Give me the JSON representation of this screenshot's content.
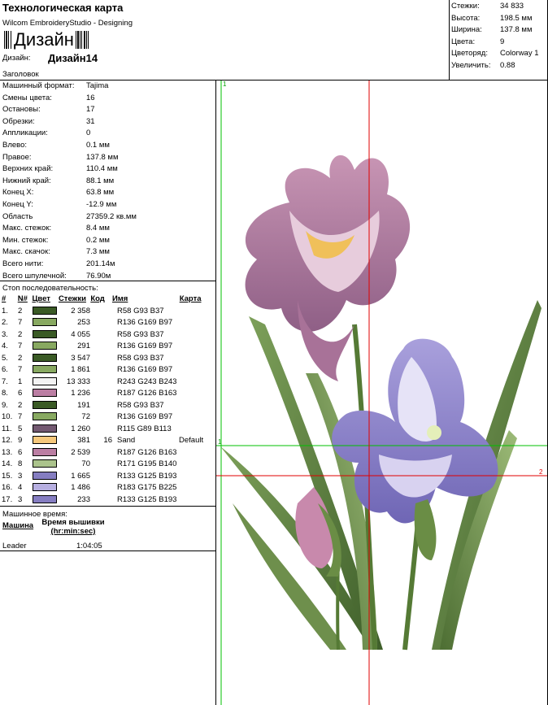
{
  "header": {
    "title": "Технологическая карта",
    "subtitle": "Wilcom EmbroideryStudio - Designing",
    "barcode_text": "Дизайн",
    "design_label": "Дизайн:",
    "design_name": "Дизайн14",
    "heading_label": "Заголовок"
  },
  "top_stats": [
    {
      "k": "Стежки:",
      "v": "34 833"
    },
    {
      "k": "Высота:",
      "v": "198.5 мм"
    },
    {
      "k": "Ширина:",
      "v": "137.8 мм"
    },
    {
      "k": "Цвета:",
      "v": "9"
    },
    {
      "k": "Цветоряд:",
      "v": "Colorway 1"
    },
    {
      "k": "Увеличить:",
      "v": "0.88"
    }
  ],
  "info": [
    {
      "k": "Машинный формат:",
      "v": "Tajima"
    },
    {
      "k": "Смены цвета:",
      "v": "16"
    },
    {
      "k": "Остановы:",
      "v": "17"
    },
    {
      "k": "Обрезки:",
      "v": "31"
    },
    {
      "k": "Аппликации:",
      "v": "0"
    },
    {
      "k": "Влево:",
      "v": "0.1 мм"
    },
    {
      "k": "Правое:",
      "v": "137.8 мм"
    },
    {
      "k": "Верхних край:",
      "v": "110.4 мм"
    },
    {
      "k": "Нижний край:",
      "v": "88.1 мм"
    },
    {
      "k": "Конец X:",
      "v": "63.8 мм"
    },
    {
      "k": "Конец Y:",
      "v": "-12.9 мм"
    },
    {
      "k": "Область",
      "v": "27359.2 кв.мм"
    },
    {
      "k": "Макс. стежок:",
      "v": "8.4 мм"
    },
    {
      "k": "Мин. стежок:",
      "v": "0.2 мм"
    },
    {
      "k": "Макс. скачок:",
      "v": "7.3 мм"
    },
    {
      "k": "Всего нити:",
      "v": "201.14м"
    },
    {
      "k": "Всего шпулечной:",
      "v": "76.90м"
    }
  ],
  "stop_sequence": {
    "title": "Стоп последовательность:",
    "headers": {
      "num": "#",
      "n": "N#",
      "color": "Цвет",
      "stitches": "Стежки",
      "code": "Код",
      "name": "Имя",
      "chart": "Карта"
    },
    "rows": [
      {
        "num": "1.",
        "n": "2",
        "color": "#3a5a25",
        "stitches": "2 358",
        "code": "",
        "name": "R58 G93 B37",
        "chart": ""
      },
      {
        "num": "2.",
        "n": "7",
        "color": "#88a961",
        "stitches": "253",
        "code": "",
        "name": "R136 G169 B97",
        "chart": ""
      },
      {
        "num": "3.",
        "n": "2",
        "color": "#3a5a25",
        "stitches": "4 055",
        "code": "",
        "name": "R58 G93 B37",
        "chart": ""
      },
      {
        "num": "4.",
        "n": "7",
        "color": "#88a961",
        "stitches": "291",
        "code": "",
        "name": "R136 G169 B97",
        "chart": ""
      },
      {
        "num": "5.",
        "n": "2",
        "color": "#3a5a25",
        "stitches": "3 547",
        "code": "",
        "name": "R58 G93 B37",
        "chart": ""
      },
      {
        "num": "6.",
        "n": "7",
        "color": "#88a961",
        "stitches": "1 861",
        "code": "",
        "name": "R136 G169 B97",
        "chart": ""
      },
      {
        "num": "7.",
        "n": "1",
        "color": "#f3f3f3",
        "stitches": "13 333",
        "code": "",
        "name": "R243 G243 B243",
        "chart": ""
      },
      {
        "num": "8.",
        "n": "6",
        "color": "#bb7ea3",
        "stitches": "1 236",
        "code": "",
        "name": "R187 G126 B163",
        "chart": ""
      },
      {
        "num": "9.",
        "n": "2",
        "color": "#3a5a25",
        "stitches": "191",
        "code": "",
        "name": "R58 G93 B37",
        "chart": ""
      },
      {
        "num": "10.",
        "n": "7",
        "color": "#88a961",
        "stitches": "72",
        "code": "",
        "name": "R136 G169 B97",
        "chart": ""
      },
      {
        "num": "11.",
        "n": "5",
        "color": "#735971",
        "stitches": "1 260",
        "code": "",
        "name": "R115 G89 B113",
        "chart": ""
      },
      {
        "num": "12.",
        "n": "9",
        "color": "#f6c87c",
        "stitches": "381",
        "code": "16",
        "name": "Sand",
        "chart": "Default"
      },
      {
        "num": "13.",
        "n": "6",
        "color": "#bb7ea3",
        "stitches": "2 539",
        "code": "",
        "name": "R187 G126 B163",
        "chart": ""
      },
      {
        "num": "14.",
        "n": "8",
        "color": "#abc38c",
        "stitches": "70",
        "code": "",
        "name": "R171 G195 B140",
        "chart": ""
      },
      {
        "num": "15.",
        "n": "3",
        "color": "#857dc1",
        "stitches": "1 665",
        "code": "",
        "name": "R133 G125 B193",
        "chart": ""
      },
      {
        "num": "16.",
        "n": "4",
        "color": "#b7afe1",
        "stitches": "1 486",
        "code": "",
        "name": "R183 G175 B225",
        "chart": ""
      },
      {
        "num": "17.",
        "n": "3",
        "color": "#857dc1",
        "stitches": "233",
        "code": "",
        "name": "R133 G125 B193",
        "chart": ""
      }
    ]
  },
  "machine_time": {
    "title": "Машинное время:",
    "col_machine": "Машина",
    "col_time": "Время вышивки",
    "col_unit": "(hr:min:sec)",
    "machine": "Leader",
    "time": "1:04:05"
  },
  "preview": {
    "marker_top": "1",
    "marker_left": "1",
    "marker_right": "2",
    "guide_green": "#00c000",
    "guide_red": "#e00000"
  }
}
